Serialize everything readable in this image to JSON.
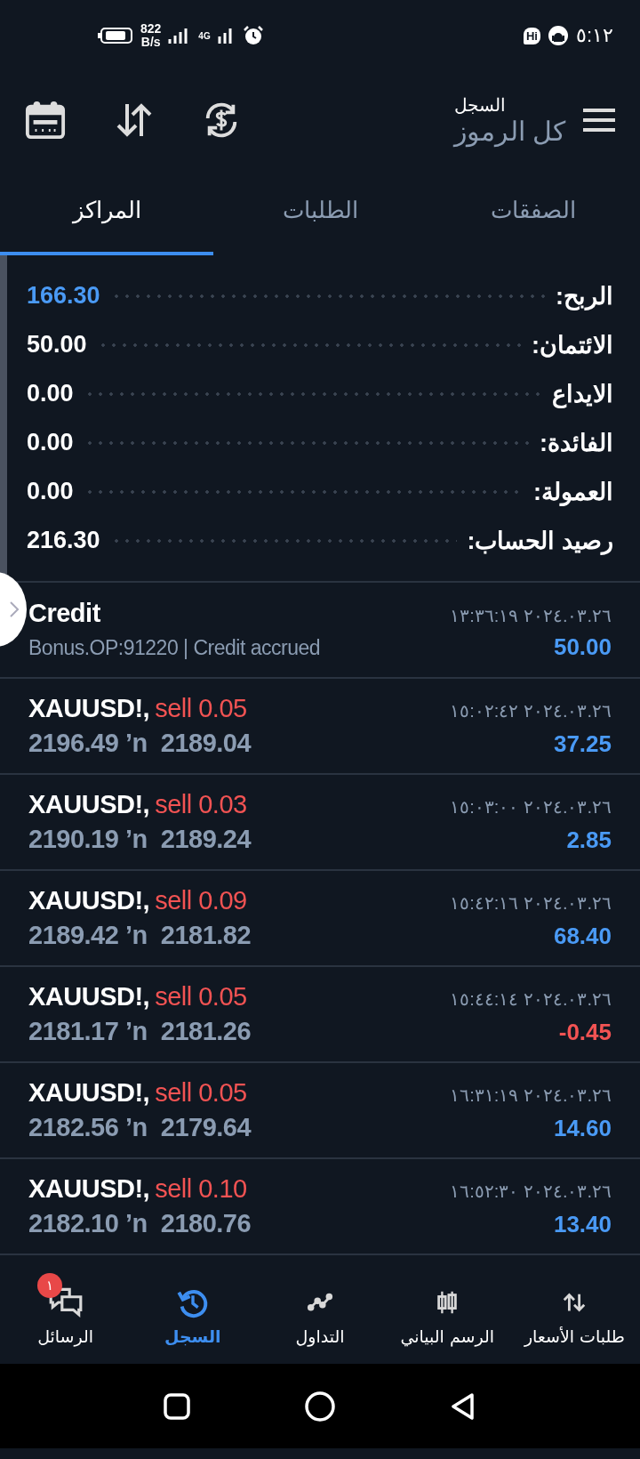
{
  "status_bar": {
    "speed": "822",
    "speed_unit": "B/s",
    "network": "4G",
    "badge": "Hi",
    "time": "٥:١٢"
  },
  "header": {
    "title": "السجل",
    "subtitle": "كل الرموز"
  },
  "tabs": [
    {
      "label": "الصفقات",
      "selected": false
    },
    {
      "label": "الطلبات",
      "selected": false
    },
    {
      "label": "المراكز",
      "selected": true
    }
  ],
  "summary": [
    {
      "label": "الربح:",
      "value": "166.30",
      "color": "#4a9af5"
    },
    {
      "label": "الائتمان:",
      "value": "50.00",
      "color": "#ffffff"
    },
    {
      "label": "الايداع",
      "value": "0.00",
      "color": "#ffffff"
    },
    {
      "label": "الفائدة:",
      "value": "0.00",
      "color": "#ffffff"
    },
    {
      "label": "العمولة:",
      "value": "0.00",
      "color": "#ffffff"
    },
    {
      "label": "رصيد الحساب:",
      "value": "216.30",
      "color": "#ffffff"
    }
  ],
  "deals": [
    {
      "kind": "credit",
      "title": "Credit",
      "detail": "Bonus.OP:91220 | Credit accrued",
      "time": "٢٠٢٤.٠٣.٢٦ ١٣:٣٦:١٩",
      "profit": "50.00",
      "color": "#4a9af5"
    },
    {
      "kind": "trade",
      "symbol": "XAUUSD!,",
      "side": "sell 0.05",
      "prices": "2196.49 ’n  2189.04",
      "time": "٢٠٢٤.٠٣.٢٦ ١٥:٠٢:٤٢",
      "profit": "37.25",
      "color": "#4a9af5"
    },
    {
      "kind": "trade",
      "symbol": "XAUUSD!,",
      "side": "sell 0.03",
      "prices": "2190.19 ’n  2189.24",
      "time": "٢٠٢٤.٠٣.٢٦ ١٥:٠٣:٠٠",
      "profit": "2.85",
      "color": "#4a9af5"
    },
    {
      "kind": "trade",
      "symbol": "XAUUSD!,",
      "side": "sell 0.09",
      "prices": "2189.42 ’n  2181.82",
      "time": "٢٠٢٤.٠٣.٢٦ ١٥:٤٢:١٦",
      "profit": "68.40",
      "color": "#4a9af5"
    },
    {
      "kind": "trade",
      "symbol": "XAUUSD!,",
      "side": "sell 0.05",
      "prices": "2181.17 ’n  2181.26",
      "time": "٢٠٢٤.٠٣.٢٦ ١٥:٤٤:١٤",
      "profit": "-0.45",
      "color": "#f25353"
    },
    {
      "kind": "trade",
      "symbol": "XAUUSD!,",
      "side": "sell 0.05",
      "prices": "2182.56 ’n  2179.64",
      "time": "٢٠٢٤.٠٣.٢٦ ١٦:٣١:١٩",
      "profit": "14.60",
      "color": "#4a9af5"
    },
    {
      "kind": "trade",
      "symbol": "XAUUSD!,",
      "side": "sell 0.10",
      "prices": "2182.10 ’n  2180.76",
      "time": "٢٠٢٤.٠٣.٢٦ ١٦:٥٢:٣٠",
      "profit": "13.40",
      "color": "#4a9af5"
    }
  ],
  "bottom_nav": [
    {
      "kind": "quotes",
      "label": "طلبات الأسعار",
      "selected": false
    },
    {
      "kind": "chart",
      "label": "الرسم البياني",
      "selected": false
    },
    {
      "kind": "trade",
      "label": "التداول",
      "selected": false
    },
    {
      "kind": "history",
      "label": "السجل",
      "selected": true
    },
    {
      "kind": "messages",
      "label": "الرسائل",
      "selected": false,
      "badge": "١"
    }
  ]
}
